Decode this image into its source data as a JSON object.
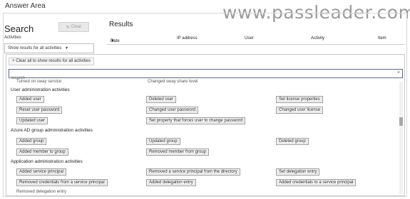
{
  "answer_area_title": "Answer Area",
  "watermark": "www.passleader.com",
  "search": {
    "title": "Search",
    "clear_label": "Clear",
    "activities_label": "Activities",
    "activities_select": "Show results for all activities"
  },
  "results": {
    "title": "Results",
    "columns": [
      "Date",
      "IP address",
      "User",
      "Activity",
      "Item"
    ]
  },
  "dropdown": {
    "clear_all_label": "Clear all to show results for all activities",
    "search_placeholder": "Search",
    "partial_top_left": "Turned on sway service",
    "partial_top_mid": "Changed sway share level",
    "partial_bottom": "Removed delegation entry",
    "groups": [
      {
        "label": "User administration activities",
        "items": [
          "Added user",
          "Deleted user",
          "Set license properties",
          "Reset user password",
          "Changed user password",
          "Changed user license",
          "Updated user",
          "Set property that forces user to change password"
        ]
      },
      {
        "label": "Azure AD group administration activities",
        "items": [
          "Added group",
          "Updated group",
          "Deleted group",
          "Added member to group",
          "Removed member from group"
        ]
      },
      {
        "label": "Application administration activities",
        "items": [
          "Added service principal",
          "Removed a service principal from the directory",
          "Set delegation entry",
          "Removed credentials from a service principal",
          "Added delegation entry",
          "Added credentials to a service principal"
        ]
      }
    ]
  }
}
